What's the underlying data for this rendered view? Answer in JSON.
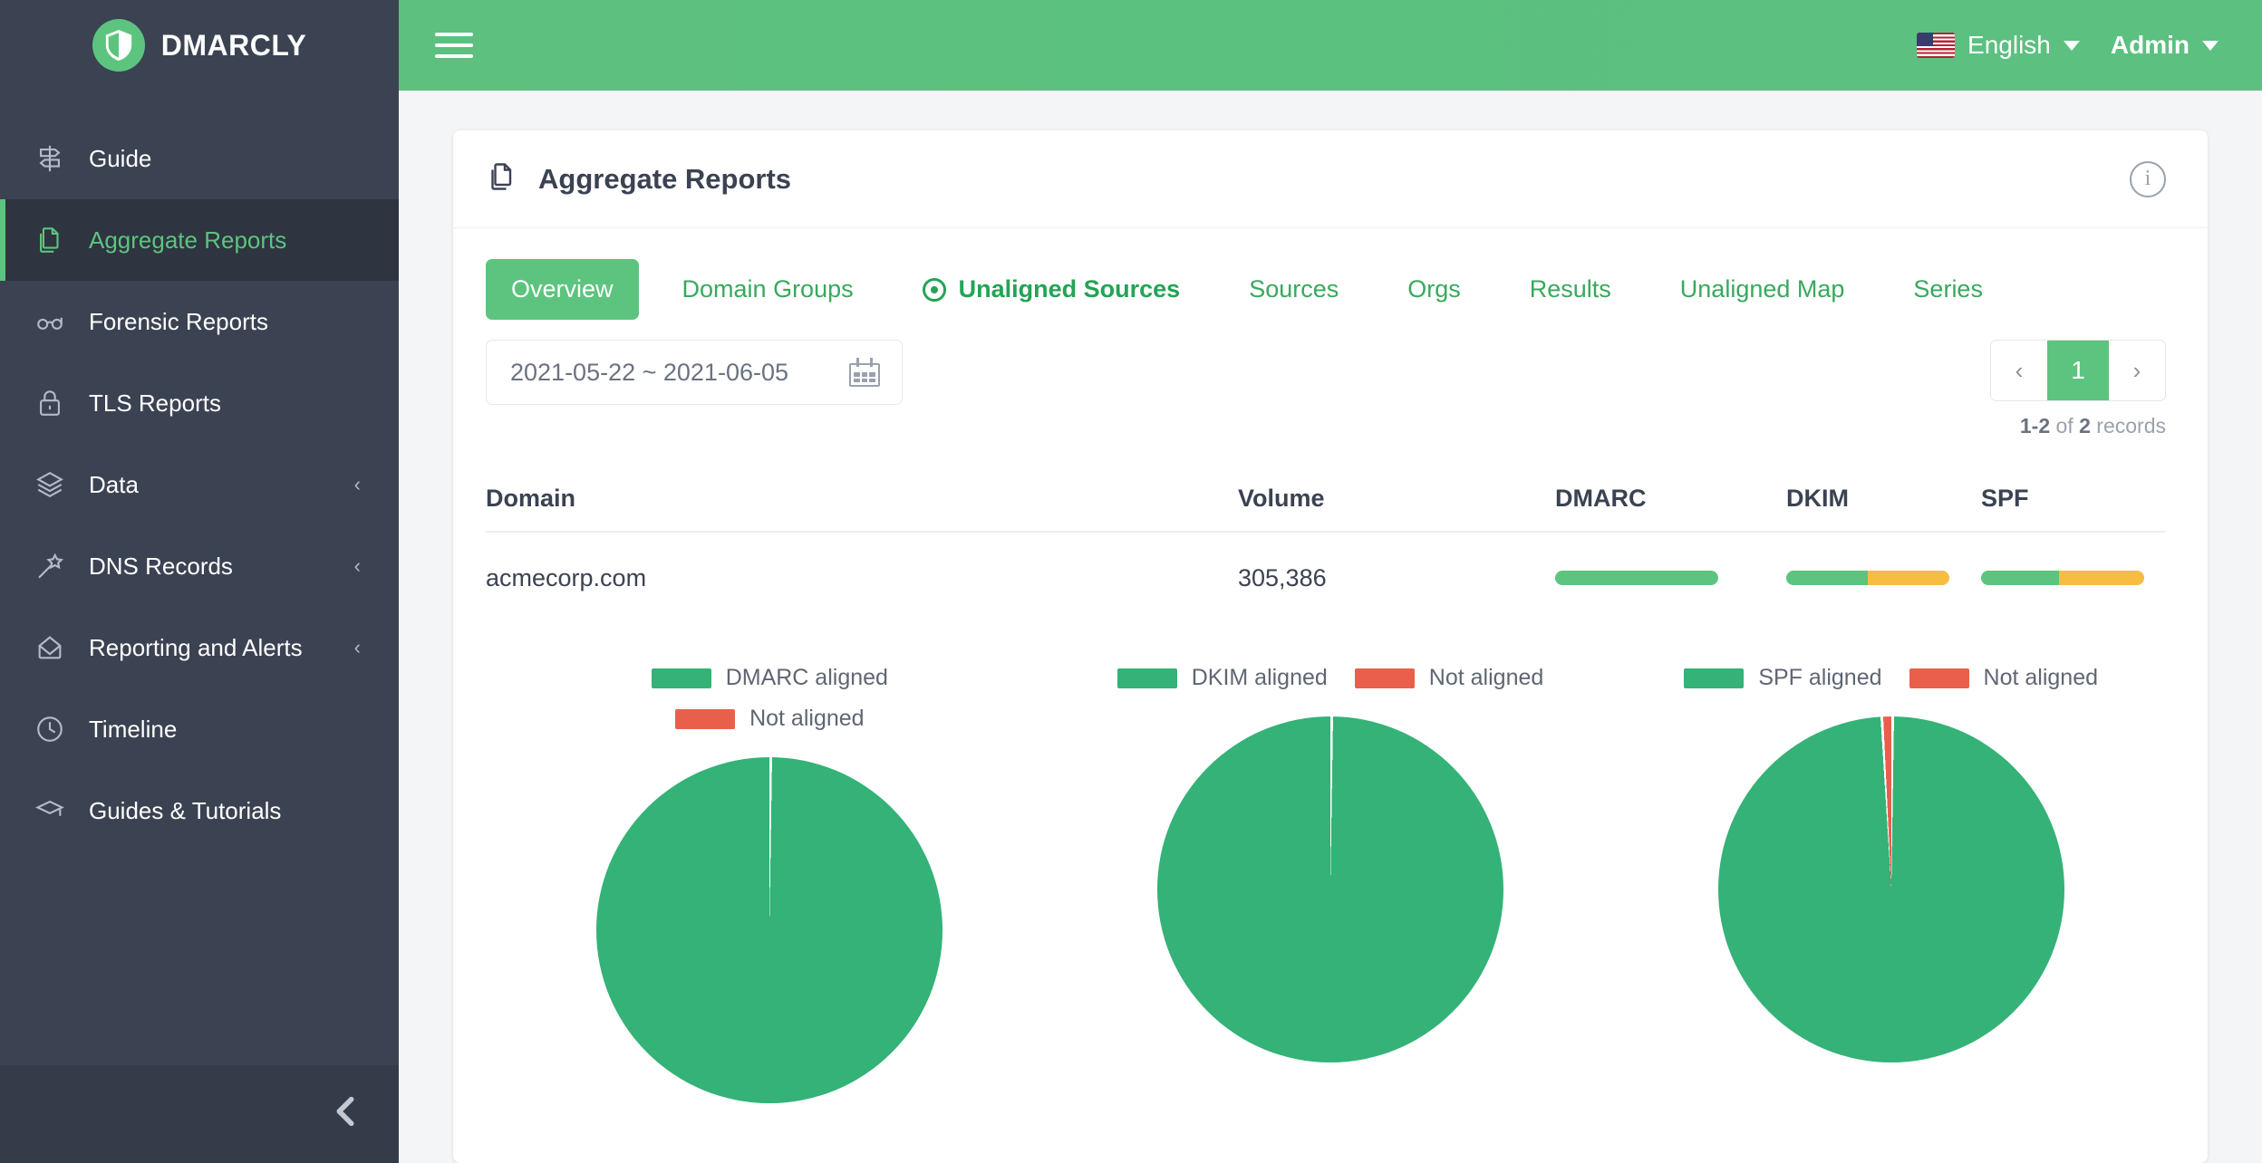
{
  "brand": {
    "name": "DMARCLY",
    "logo_icon": "shield-icon"
  },
  "sidebar": {
    "items": [
      {
        "label": "Guide",
        "icon": "signpost-icon",
        "active": false,
        "expandable": false
      },
      {
        "label": "Aggregate Reports",
        "icon": "documents-icon",
        "active": true,
        "expandable": false
      },
      {
        "label": "Forensic Reports",
        "icon": "glasses-icon",
        "active": false,
        "expandable": false
      },
      {
        "label": "TLS Reports",
        "icon": "lock-icon",
        "active": false,
        "expandable": false
      },
      {
        "label": "Data",
        "icon": "layers-icon",
        "active": false,
        "expandable": true
      },
      {
        "label": "DNS Records",
        "icon": "magic-wand-icon",
        "active": false,
        "expandable": true
      },
      {
        "label": "Reporting and Alerts",
        "icon": "open-envelope-icon",
        "active": false,
        "expandable": true
      },
      {
        "label": "Timeline",
        "icon": "clock-icon",
        "active": false,
        "expandable": false
      },
      {
        "label": "Guides & Tutorials",
        "icon": "graduation-cap-icon",
        "active": false,
        "expandable": false
      }
    ],
    "chevron_glyph": "‹",
    "collapse_glyph": "‹"
  },
  "topbar": {
    "menu_icon": "hamburger-icon",
    "language": "English",
    "language_flag": "us-flag-icon",
    "user": "Admin",
    "caret_icon": "caret-down-icon"
  },
  "card": {
    "title": "Aggregate Reports",
    "title_icon": "documents-icon",
    "info_icon": "info-icon",
    "info_glyph": "i"
  },
  "tabs": [
    {
      "label": "Overview",
      "state": "active"
    },
    {
      "label": "Domain Groups",
      "state": "link"
    },
    {
      "label": "Unaligned Sources",
      "state": "bold",
      "icon": "target-icon"
    },
    {
      "label": "Sources",
      "state": "link"
    },
    {
      "label": "Orgs",
      "state": "link"
    },
    {
      "label": "Results",
      "state": "link"
    },
    {
      "label": "Unaligned Map",
      "state": "link"
    },
    {
      "label": "Series",
      "state": "link"
    }
  ],
  "toolbar": {
    "date_range": "2021-05-22 ~ 2021-06-05",
    "calendar_icon": "calendar-icon",
    "pager": {
      "prev_glyph": "‹",
      "next_glyph": "›",
      "current_page": "1",
      "records_range": "1-2",
      "records_of": "of",
      "records_total": "2",
      "records_suffix": "records"
    }
  },
  "table": {
    "columns": [
      "Domain",
      "Volume",
      "DMARC",
      "DKIM",
      "SPF"
    ],
    "rows": [
      {
        "domain": "acmecorp.com",
        "volume": "305,386",
        "dmarc_pct": 100,
        "dkim_pct": 50,
        "spf_pct": 48
      }
    ]
  },
  "colors": {
    "green": "#5cc47e",
    "pie_green": "#34b277",
    "red": "#e8604c",
    "yellow": "#f7bc42",
    "sidebar": "#3b4252",
    "sidebar_active": "#2e3440",
    "track": "#e9ecf1"
  },
  "chart_data": [
    {
      "type": "pie",
      "title": "DMARC",
      "legend": [
        {
          "name": "DMARC aligned",
          "color": "#34b277"
        },
        {
          "name": "Not aligned",
          "color": "#e8604c"
        }
      ],
      "categories": [
        "DMARC aligned",
        "Not aligned"
      ],
      "values": [
        100,
        0
      ],
      "legend_position": "top",
      "legend_wrap": "stacked"
    },
    {
      "type": "pie",
      "title": "DKIM",
      "legend": [
        {
          "name": "DKIM aligned",
          "color": "#34b277"
        },
        {
          "name": "Not aligned",
          "color": "#e8604c"
        }
      ],
      "categories": [
        "DKIM aligned",
        "Not aligned"
      ],
      "values": [
        100,
        0
      ],
      "legend_position": "top",
      "legend_wrap": "inline"
    },
    {
      "type": "pie",
      "title": "SPF",
      "legend": [
        {
          "name": "SPF aligned",
          "color": "#34b277"
        },
        {
          "name": "Not aligned",
          "color": "#e8604c"
        }
      ],
      "categories": [
        "SPF aligned",
        "Not aligned"
      ],
      "values": [
        99,
        1
      ],
      "legend_position": "top",
      "legend_wrap": "inline"
    }
  ]
}
